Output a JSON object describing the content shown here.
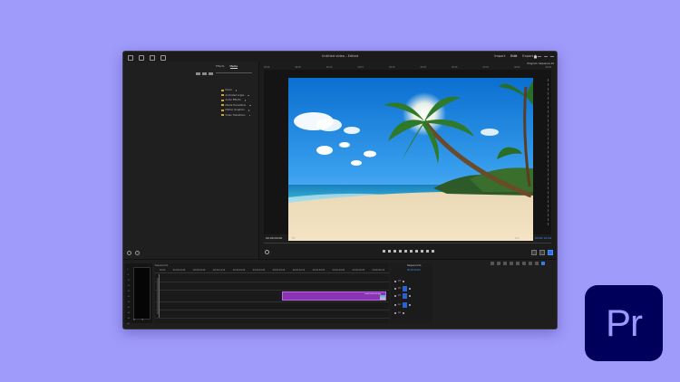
{
  "colors": {
    "background": "#9f9bfb",
    "accent": "#4a8fff",
    "clip": "#8a34b5",
    "logo_bg": "#00005b",
    "logo_fg": "#9999ff"
  },
  "titlebar": {
    "title": "Untitled video - Edited",
    "workspaces": [
      "Import",
      "Edit",
      "Export"
    ],
    "home_icon": "home-icon",
    "window_icons": [
      "minimize-icon",
      "maximize-icon",
      "close-icon"
    ]
  },
  "media_panel": {
    "tabs": [
      "Effects",
      "Media"
    ],
    "bins": [
      "Music",
      "Animated Logos",
      "Audio Effects",
      "Media Transitions",
      "Motion Graphics",
      "Video Transitions"
    ]
  },
  "program": {
    "header": "Program: Sequence 01",
    "ruler_ticks": [
      "00:00",
      "00:05",
      "00:10",
      "00:15",
      "00:20",
      "00:25",
      "00:30",
      "00:35",
      "00:40",
      "00:45"
    ],
    "timecode_left": "00;00;00;00",
    "fit_label": "Fit",
    "full_label": "Full",
    "timecode_right": "00;00;10;04",
    "image": "tropical-beach-palm-tree"
  },
  "timeline": {
    "sequence_name": "Sequence 01",
    "timecode": "00;00;00;00",
    "ruler_ticks": [
      "00;00",
      "00;00;04;29",
      "00;00;09;29",
      "00;00;14;29",
      "00;00;19;29",
      "00;00;24;29",
      "00;00;29;29",
      "00;00;34;29",
      "00;00;39;29",
      "00;00;44;29",
      "00;00;49;29",
      "00;00;54;29"
    ],
    "clip_label": "tropical beach.jpg",
    "tracks": [
      "V3",
      "V2",
      "V1",
      "A1",
      "A2"
    ]
  },
  "meter": {
    "scale": [
      "0",
      "-6",
      "-12",
      "-18",
      "-24",
      "-30",
      "-36",
      "-42",
      "-48",
      "-54",
      "dB"
    ],
    "buttons": [
      "S",
      "S"
    ]
  },
  "logo": {
    "text": "Pr"
  }
}
